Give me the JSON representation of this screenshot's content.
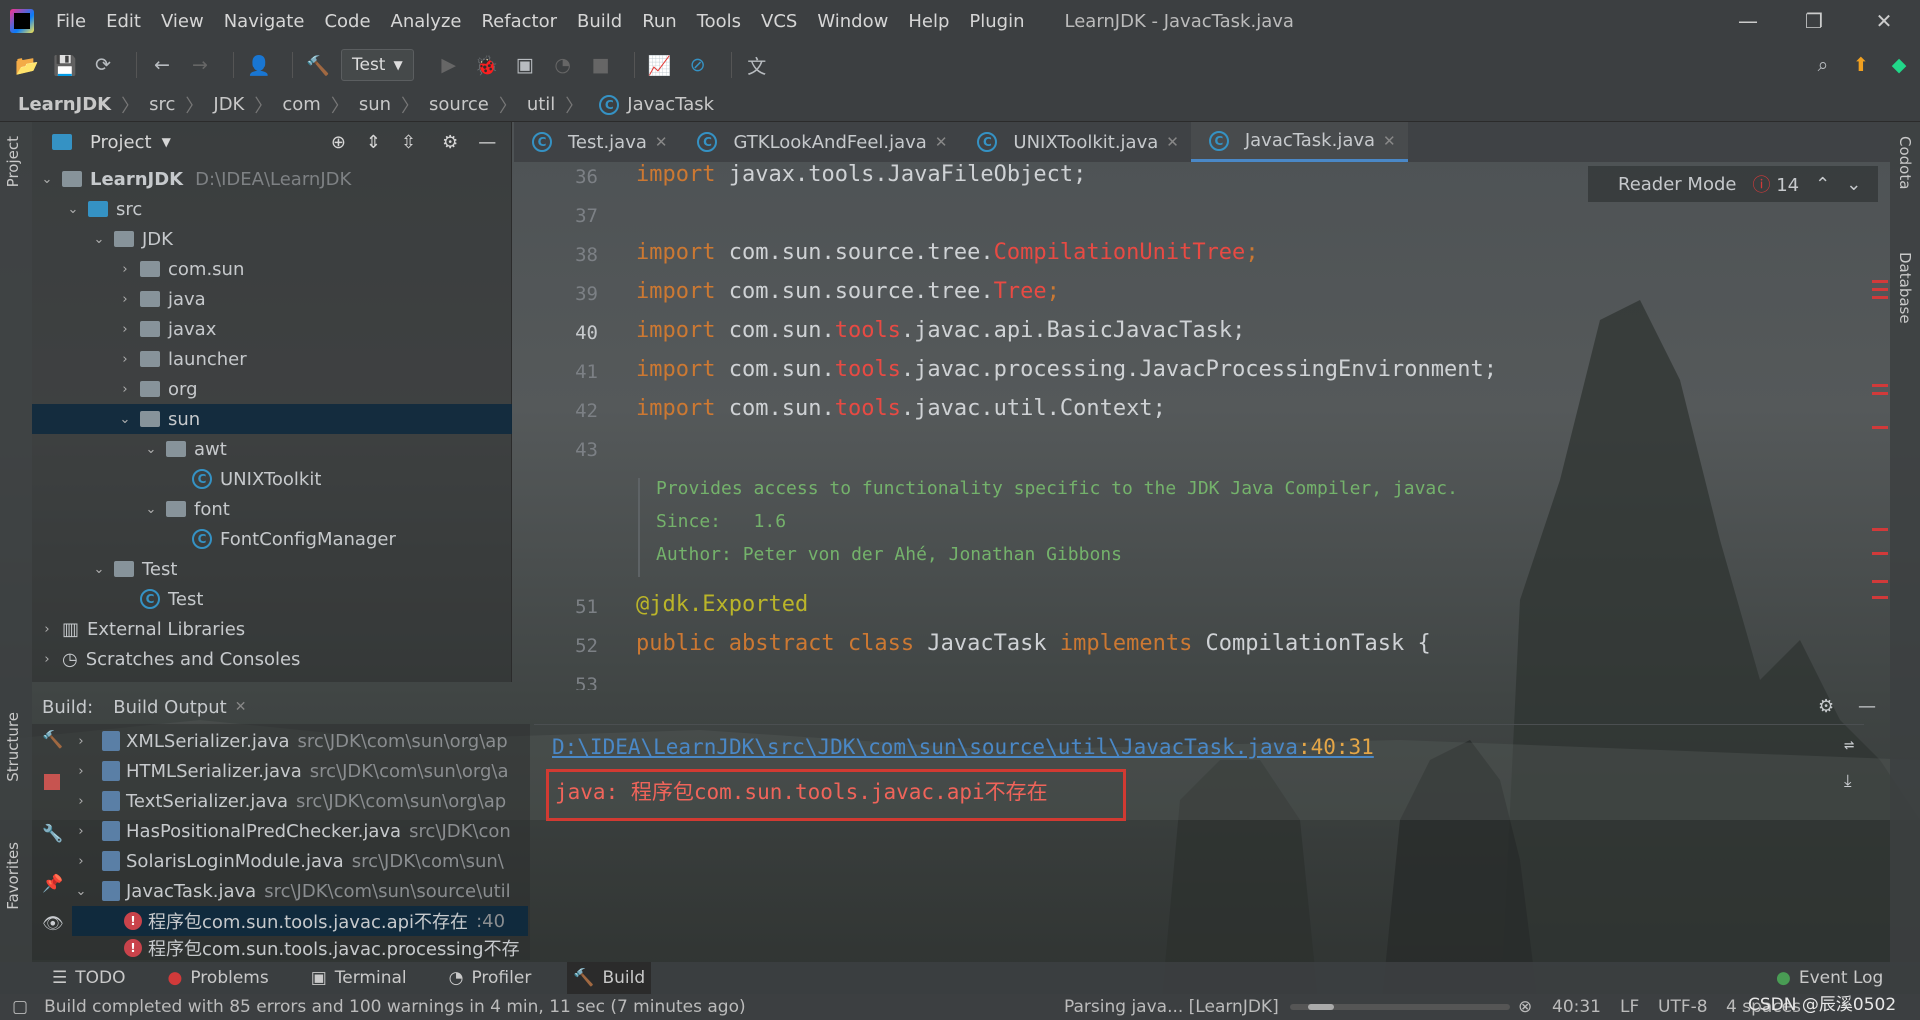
{
  "menu": [
    "File",
    "Edit",
    "View",
    "Navigate",
    "Code",
    "Analyze",
    "Refactor",
    "Build",
    "Run",
    "Tools",
    "VCS",
    "Window",
    "Help",
    "Plugin"
  ],
  "window_title": "LearnJDK - JavacTask.java",
  "run_config": "Test",
  "breadcrumb": [
    "LearnJDK",
    "src",
    "JDK",
    "com",
    "sun",
    "source",
    "util",
    "JavacTask"
  ],
  "project": {
    "title": "Project",
    "root_name": "LearnJDK",
    "root_path": "D:\\IDEA\\LearnJDK",
    "items": [
      {
        "label": "src"
      },
      {
        "label": "JDK"
      },
      {
        "label": "com.sun"
      },
      {
        "label": "java"
      },
      {
        "label": "javax"
      },
      {
        "label": "launcher"
      },
      {
        "label": "org"
      },
      {
        "label": "sun"
      },
      {
        "label": "awt"
      },
      {
        "label": "UNIXToolkit"
      },
      {
        "label": "font"
      },
      {
        "label": "FontConfigManager"
      },
      {
        "label": "Test"
      },
      {
        "label": "Test"
      },
      {
        "label": "External Libraries"
      },
      {
        "label": "Scratches and Consoles"
      }
    ]
  },
  "left_stripe": {
    "project": "Project",
    "structure": "Structure",
    "favorites": "Favorites"
  },
  "right_stripe": {
    "codota": "Codota",
    "database": "Database"
  },
  "editor": {
    "tabs": [
      {
        "label": "Test.java"
      },
      {
        "label": "GTKLookAndFeel.java"
      },
      {
        "label": "UNIXToolkit.java"
      },
      {
        "label": "JavacTask.java"
      }
    ],
    "reader_mode": "Reader Mode",
    "error_count": "14",
    "line_numbers": [
      "36",
      "37",
      "38",
      "39",
      "40",
      "41",
      "42",
      "43",
      "51",
      "52",
      "53"
    ],
    "lines": {
      "l36": {
        "kw": "import",
        "rest": " javax.tools.JavaFileObject;"
      },
      "l38": {
        "kw": "import",
        "pkg": " com.sun.source.tree.",
        "err": "CompilationUnitTree",
        "end": ";"
      },
      "l39": {
        "kw": "import",
        "pkg": " com.sun.source.tree.",
        "err": "Tree",
        "end": ";"
      },
      "l40": {
        "kw": "import",
        "pkg": " com.sun.",
        "err": "tools",
        "rest": ".javac.api.BasicJavacTask;"
      },
      "l41": {
        "kw": "import",
        "pkg": " com.sun.",
        "err": "tools",
        "rest": ".javac.processing.JavacProcessingEnvironment;"
      },
      "l42": {
        "kw": "import",
        "pkg": " com.sun.",
        "err": "tools",
        "rest": ".javac.util.Context;"
      },
      "l51": {
        "at": "@jdk.",
        "ann": "Exported"
      },
      "l52": {
        "kw1": "public abstract class",
        "name": " JavacTask ",
        "kw2": "implements",
        "rest": " CompilationTask {"
      }
    },
    "doc": {
      "line1": "Provides access to functionality specific to the JDK Java Compiler, javac.",
      "since_label": "Since:",
      "since_value": "1.6",
      "author_label": "Author:",
      "author_value": "Peter von der Ahé, Jonathan Gibbons"
    }
  },
  "build": {
    "label": "Build:",
    "tab": "Build Output",
    "rows": [
      {
        "name": "XMLSerializer.java",
        "path": "src\\JDK\\com\\sun\\org\\ap"
      },
      {
        "name": "HTMLSerializer.java",
        "path": "src\\JDK\\com\\sun\\org\\a"
      },
      {
        "name": "TextSerializer.java",
        "path": "src\\JDK\\com\\sun\\org\\ap"
      },
      {
        "name": "HasPositionalPredChecker.java",
        "path": "src\\JDK\\con"
      },
      {
        "name": "SolarisLoginModule.java",
        "path": "src\\JDK\\com\\sun\\"
      },
      {
        "name": "JavacTask.java",
        "path": "src\\JDK\\com\\sun\\source\\util"
      },
      {
        "name": "程序包com.sun.tools.javac.api不存在",
        "path": ":40"
      },
      {
        "name": "程序包com.sun.tools.javac.processing不存",
        "path": ""
      }
    ],
    "console_link": "D:\\IDEA\\LearnJDK\\src\\JDK\\com\\sun\\source\\util\\JavacTask.java",
    "console_pos": ":40:31",
    "console_error": "java: 程序包com.sun.tools.javac.api不存在"
  },
  "bottom_tabs": [
    "TODO",
    "Problems",
    "Terminal",
    "Profiler",
    "Build"
  ],
  "event_log": "Event Log",
  "status": {
    "message": "Build completed with 85 errors and 100 warnings in 4 min, 11 sec (7 minutes ago)",
    "parsing": "Parsing java... [LearnJDK]",
    "position": "40:31",
    "line_sep": "LF",
    "encoding": "UTF-8",
    "indent": "4 spaces",
    "watermark": "CSDN @辰溪0502"
  }
}
